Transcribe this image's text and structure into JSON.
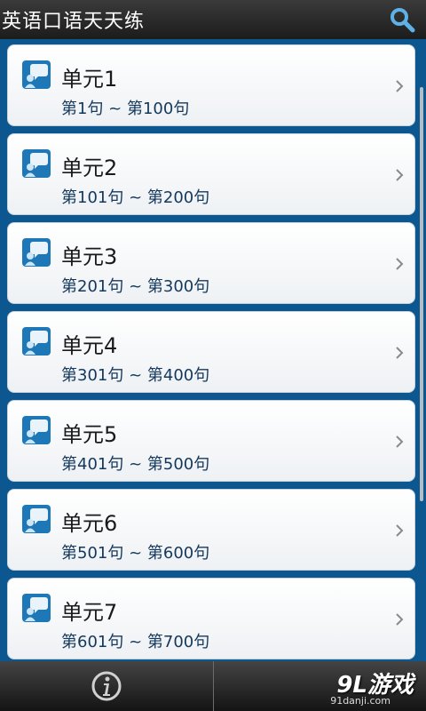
{
  "header": {
    "title": "英语口语天天练",
    "search_icon": "search-icon"
  },
  "units": [
    {
      "title": "单元1",
      "range": "第1句 ~ 第100句"
    },
    {
      "title": "单元2",
      "range": "第101句 ~ 第200句"
    },
    {
      "title": "单元3",
      "range": "第201句 ~ 第300句"
    },
    {
      "title": "单元4",
      "range": "第301句 ~ 第400句"
    },
    {
      "title": "单元5",
      "range": "第401句 ~ 第500句"
    },
    {
      "title": "单元6",
      "range": "第501句 ~ 第600句"
    },
    {
      "title": "单元7",
      "range": "第601句 ~ 第700句"
    }
  ],
  "footer": {
    "info_icon": "info-icon",
    "watermark": "9L游戏",
    "watermark_sub": "91danji.com"
  },
  "colors": {
    "background": "#0b4f86",
    "item_icon": "#1e77b6",
    "chevron": "#8a8a8a"
  }
}
